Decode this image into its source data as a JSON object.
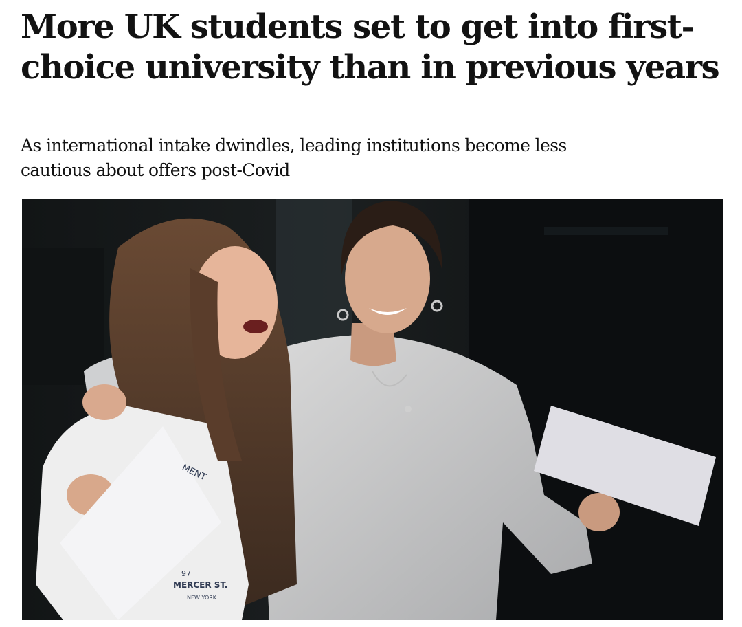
{
  "article": {
    "headline": "More UK students set to get into first-choice university than in previous years",
    "standfirst": "As international intake dwindles, leading institutions become less cautious about offers post-Covid"
  },
  "photo": {
    "shirt_print_top": "MENT",
    "shirt_print_number": "97",
    "shirt_print_street": "MERCER ST.",
    "shirt_print_city": "NEW YORK"
  }
}
